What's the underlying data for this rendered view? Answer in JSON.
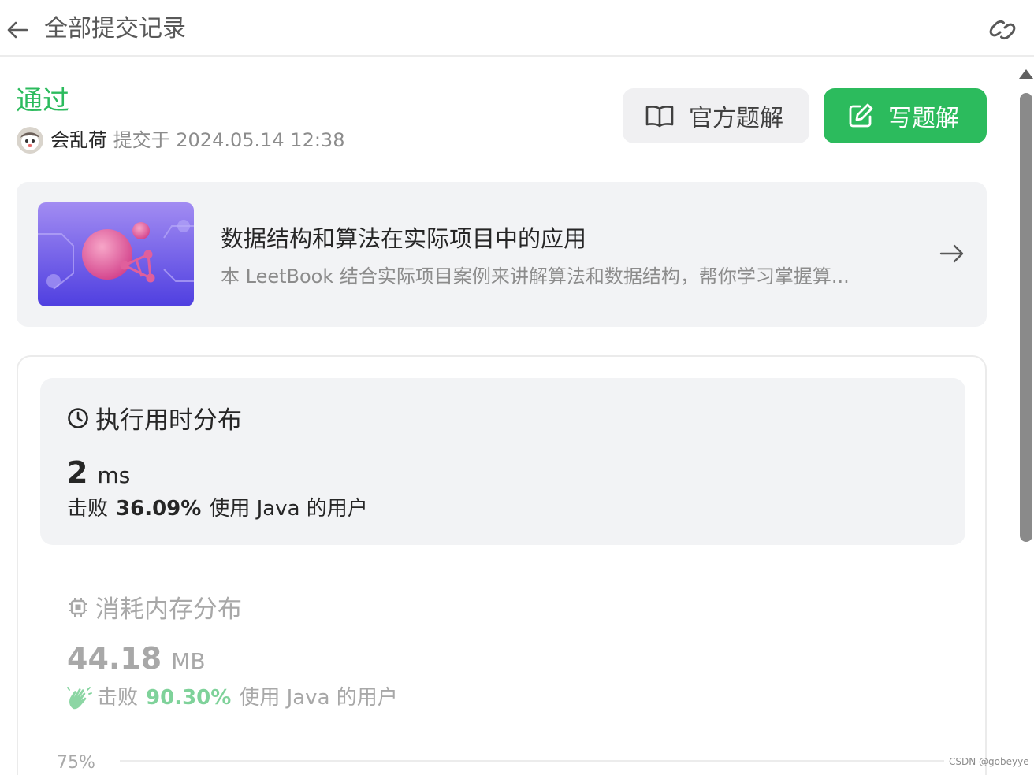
{
  "header": {
    "title": "全部提交记录"
  },
  "submission": {
    "status": "通过",
    "user": "会乱荷",
    "submitted_text": "提交于 2024.05.14 12:38"
  },
  "buttons": {
    "official_solution": "官方题解",
    "write_solution": "写题解"
  },
  "book": {
    "title": "数据结构和算法在实际项目中的应用",
    "description": "本 LeetBook 结合实际项目案例来讲解算法和数据结构，帮你学习掌握算..."
  },
  "runtime": {
    "heading": "执行用时分布",
    "value": "2",
    "unit": "ms",
    "beats_prefix": "击败",
    "beats_pct": "36.09%",
    "beats_suffix": "使用 Java 的用户"
  },
  "memory": {
    "heading": "消耗内存分布",
    "value": "44.18",
    "unit": "MB",
    "beats_prefix": "击败",
    "beats_pct": "90.30%",
    "beats_suffix": "使用 Java 的用户"
  },
  "chart": {
    "tick_label": "75%"
  },
  "watermark": "CSDN @gobeyye",
  "colors": {
    "accent_green": "#2cbb5d",
    "muted_green": "#7fd29a"
  }
}
